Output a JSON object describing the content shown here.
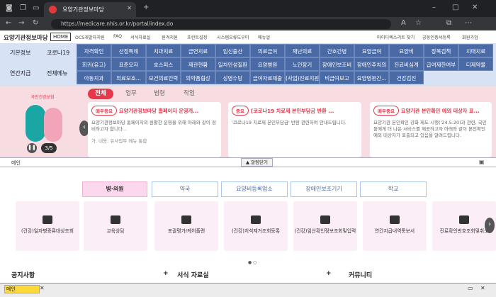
{
  "browser": {
    "tab_title": "요양기관정보마당",
    "url": "https://medicare.nhis.or.kr/portal/index.do"
  },
  "header": {
    "site_title": "요양기관정보마당",
    "home_label": "HOME",
    "utilities": [
      "OCS개발자지원",
      "FAQ",
      "서식자료실",
      "원격지원",
      "프린트설정",
      "시스템오류도우미",
      "매뉴얼"
    ],
    "right_links": [
      "마이디렉스리트 찾기",
      "공동인증서등록",
      "회원가입"
    ]
  },
  "menu": {
    "categories": [
      "기본정보",
      "코로나19",
      "연간지급",
      "전체메뉴"
    ],
    "rows": [
      [
        "자격확인",
        "산정특례",
        "치과치료",
        "금연치료",
        "임신출산",
        "의료급여",
        "재난의료",
        "간호간병",
        "요양급여",
        "요양비",
        "장복검책",
        "치매치료"
      ],
      [
        "희귀(유고)",
        "표준모자",
        "호스피스",
        "재관현황",
        "일차만성질환",
        "요양병원",
        "노인장기",
        "장애인보조비",
        "장애인주치의",
        "진료비심계",
        "급여제한여부",
        "디제약물"
      ],
      [
        "아동치과",
        "의료보호...",
        "보건의료인력",
        "의약품협상",
        "상병수당",
        "급여자료제출",
        "(사업)진료지원",
        "비급여보고",
        "요양병원간...",
        "건강검진"
      ]
    ]
  },
  "banner": {
    "tabs": [
      "전체",
      "업무",
      "법령",
      "작업"
    ],
    "mascot_caption": "국민건강보험",
    "page_indicator": "3/5",
    "cards": [
      {
        "badge": "매우중요",
        "title": "요양기관정보마당 홈페이지 운영개...",
        "body": "요양기관정보마당 홈페이지의 원활한 운영을 위해 아래와 같이 정비하고자 합니다...",
        "category": "가. 내용: 유사업무 메뉴 통합"
      },
      {
        "badge": "중요",
        "title": "[코로나19 치료제 본인부담금 반환 ...",
        "body": "'코로나19 치료제 본인부담금' 반환 관련하여 안내드립니다.",
        "category": ""
      },
      {
        "badge": "매우중요",
        "title": "요양기관 본인확인 예외 대상자 표...",
        "body": "요양기관 본인확인 강화 제도 시행('24.5.20)과 관련, 국민들에게 더 나은 서비스를 제공하고자 아래와 같이 본인확인 예외 대상자가 표출되고 있음을 알려드립니다.",
        "category": ""
      }
    ]
  },
  "panel": {
    "left_label": "메인",
    "toggle_label": "알림닫기"
  },
  "service_tabs": [
    "병·의원",
    "약국",
    "요양비등록업소",
    "장애인보조기기",
    "학교"
  ],
  "services": [
    {
      "label": "(건강)일자병증류대상조회",
      "icon": "calendar-icon"
    },
    {
      "label": "교육상담",
      "icon": "chat-icon"
    },
    {
      "label": "포괄평가/케어플랜",
      "icon": "chart-icon"
    },
    {
      "label": "(건강)치석제거조회등록",
      "icon": "tooth-icon"
    },
    {
      "label": "(건강)임산확인정보조회및입력",
      "icon": "person-icon"
    },
    {
      "label": "연간지급내역통보서",
      "icon": "mail-icon"
    },
    {
      "label": "진료확인번호조회및취소",
      "icon": "doc-icon"
    }
  ],
  "sections": [
    "공지사항",
    "서식 자료실",
    "커뮤니티"
  ],
  "statusbar": {
    "label": "메인"
  }
}
